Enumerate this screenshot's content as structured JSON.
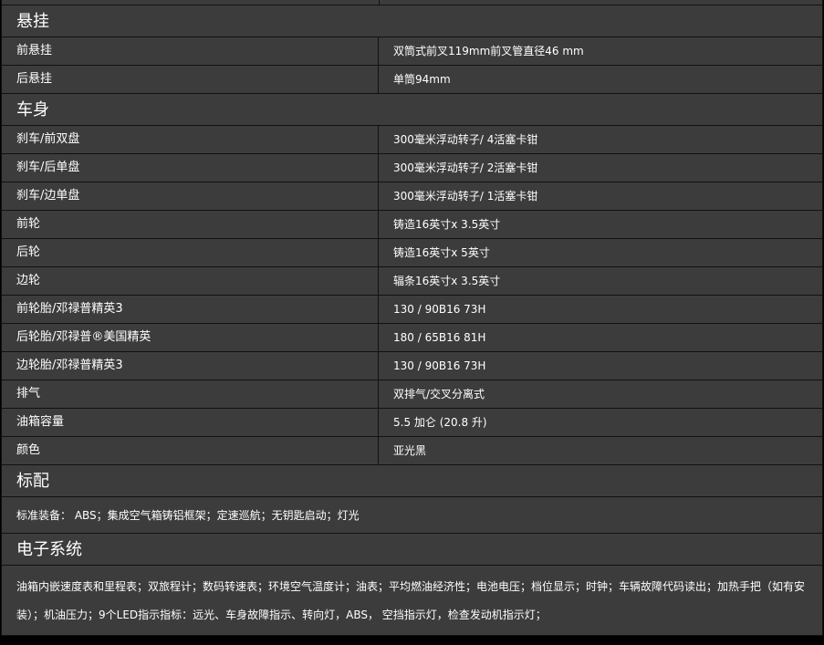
{
  "sections": {
    "suspension": {
      "title": "悬挂",
      "rows": [
        {
          "label": "前悬挂",
          "value": "双筒式前叉119mm前叉管直径46 mm"
        },
        {
          "label": "后悬挂",
          "value": "单筒94mm"
        }
      ]
    },
    "body": {
      "title": "车身",
      "rows": [
        {
          "label": "刹车/前双盘",
          "value": "300毫米浮动转子/ 4活塞卡钳"
        },
        {
          "label": "刹车/后单盘",
          "value": "300毫米浮动转子/ 2活塞卡钳"
        },
        {
          "label": "刹车/边单盘",
          "value": "300毫米浮动转子/ 1活塞卡钳"
        },
        {
          "label": "前轮",
          "value": "铸造16英寸x 3.5英寸"
        },
        {
          "label": "后轮",
          "value": "铸造16英寸x 5英寸"
        },
        {
          "label": "边轮",
          "value": "辐条16英寸x 3.5英寸"
        },
        {
          "label": "前轮胎/邓禄普精英3",
          "value": "130 / 90B16 73H"
        },
        {
          "label": "后轮胎/邓禄普®美国精英",
          "value": "180 / 65B16 81H"
        },
        {
          "label": "边轮胎/邓禄普精英3",
          "value": "130 / 90B16 73H"
        },
        {
          "label": "排气",
          "value": "双排气/交叉分离式"
        },
        {
          "label": "油箱容量",
          "value": "5.5 加仑 (20.8 升)"
        },
        {
          "label": "颜色",
          "value": "亚光黑"
        }
      ]
    },
    "standard": {
      "title": "标配",
      "text": "标准装备： ABS；集成空气箱铸铝框架；定速巡航；无钥匙启动；灯光"
    },
    "electronics": {
      "title": "电子系统",
      "text": "油箱内嵌速度表和里程表；双旅程计；数码转速表；环境空气温度计；油表；平均燃油经济性；电池电压；档位显示；时钟；车辆故障代码读出；加热手把（如有安装）；机油压力；9个LED指示指标：远光、车身故障指示、转向灯，ABS， 空挡指示灯，检查发动机指示灯；"
    }
  }
}
